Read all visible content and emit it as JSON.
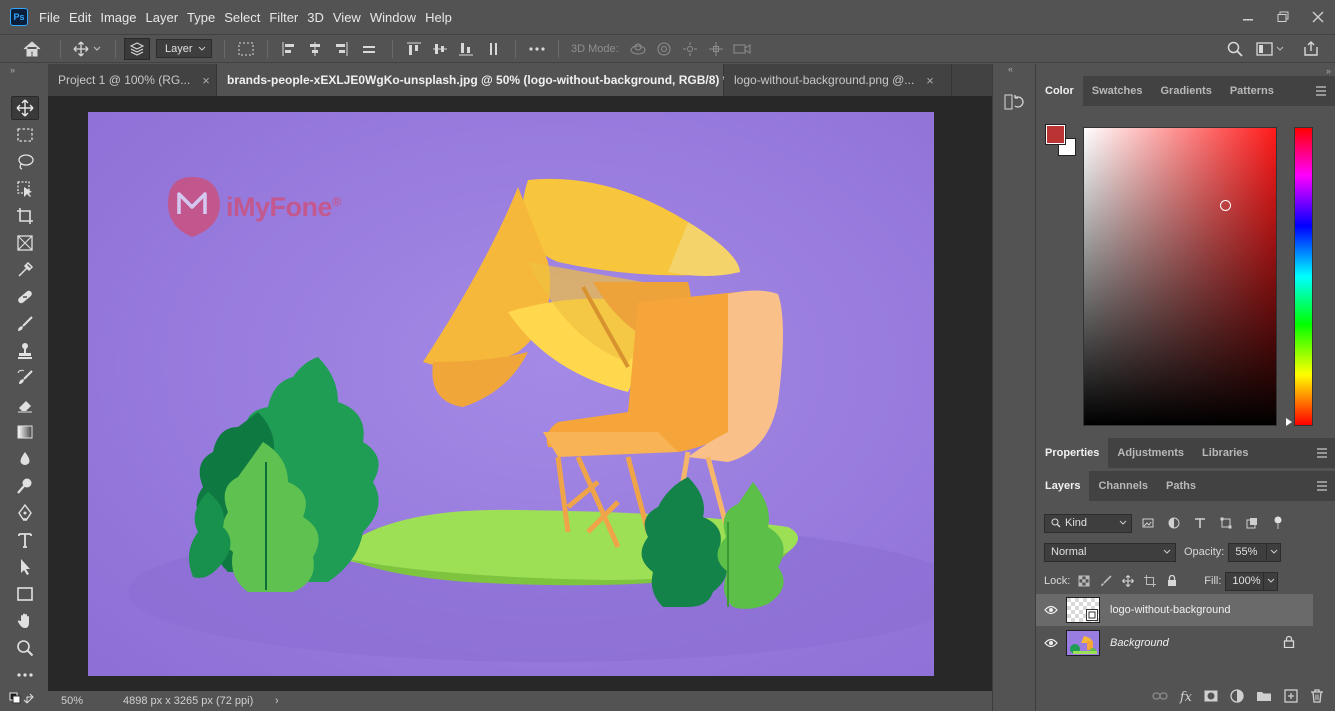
{
  "app": {
    "logo_text": "Ps",
    "menu": [
      "File",
      "Edit",
      "Image",
      "Layer",
      "Type",
      "Select",
      "Filter",
      "3D",
      "View",
      "Window",
      "Help"
    ]
  },
  "options_bar": {
    "layer_select": "Layer",
    "mode_3d_label": "3D Mode:"
  },
  "tabs": [
    {
      "label": "Project 1 @ 100% (RG...",
      "active": false
    },
    {
      "label": "brands-people-xEXLJE0WgKo-unsplash.jpg @ 50% (logo-without-background, RGB/8) *",
      "active": true
    },
    {
      "label": "logo-without-background.png @...",
      "active": false
    }
  ],
  "canvas": {
    "watermark_text": "iMyFone",
    "watermark_symbol": "®"
  },
  "status_bar": {
    "zoom": "50%",
    "doc_info": "4898 px x 3265 px (72 ppi)"
  },
  "color_panel": {
    "tabs": [
      "Color",
      "Swatches",
      "Gradients",
      "Patterns"
    ],
    "active_tab": "Color",
    "foreground_color": "#bb3333",
    "background_color": "#ffffff"
  },
  "properties_panel": {
    "tabs": [
      "Properties",
      "Adjustments",
      "Libraries"
    ]
  },
  "layers_panel": {
    "tabs": [
      "Layers",
      "Channels",
      "Paths"
    ],
    "filter_kind": "Kind",
    "blend_mode": "Normal",
    "opacity_label": "Opacity:",
    "opacity_value": "55%",
    "lock_label": "Lock:",
    "fill_label": "Fill:",
    "fill_value": "100%",
    "layers": [
      {
        "name": "logo-without-background",
        "selected": true,
        "locked": false
      },
      {
        "name": "Background",
        "selected": false,
        "locked": true
      }
    ]
  }
}
